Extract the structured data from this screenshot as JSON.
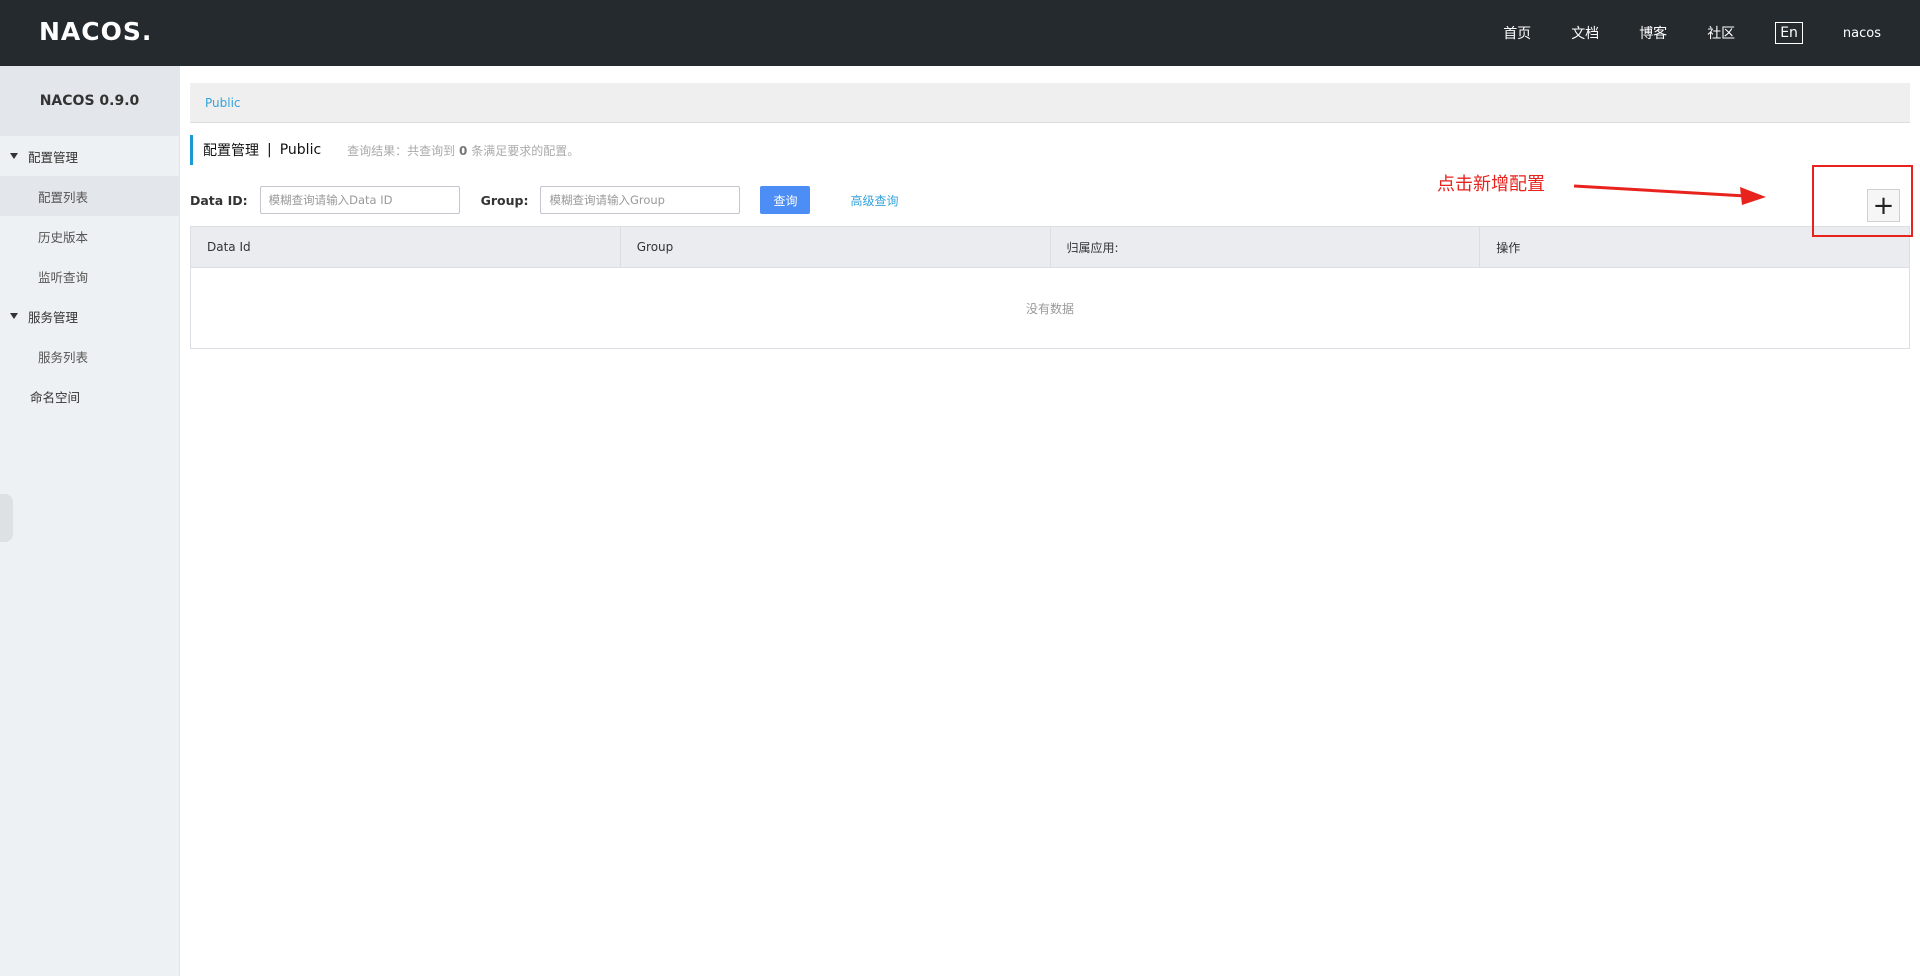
{
  "header": {
    "logo": "NACOS.",
    "nav": [
      "首页",
      "文档",
      "博客",
      "社区"
    ],
    "lang": "En",
    "user": "nacos"
  },
  "sidebar": {
    "title": "NACOS 0.9.0",
    "groups": [
      {
        "label": "配置管理",
        "items": [
          "配置列表",
          "历史版本",
          "监听查询"
        ]
      },
      {
        "label": "服务管理",
        "items": [
          "服务列表"
        ]
      }
    ],
    "top_item": "命名空间"
  },
  "breadcrumb": "Public",
  "page": {
    "title": "配置管理",
    "separator": "|",
    "namespace": "Public",
    "result_prefix": "查询结果：共查询到",
    "result_count": "0",
    "result_suffix": "条满足要求的配置。"
  },
  "search": {
    "dataid_label": "Data ID:",
    "dataid_placeholder": "模糊查询请输入Data ID",
    "group_label": "Group:",
    "group_placeholder": "模糊查询请输入Group",
    "query_button": "查询",
    "advanced_link": "高级查询"
  },
  "annotation": {
    "text": "点击新增配置",
    "color": "#e8231d"
  },
  "add_button_symbol": "+",
  "table": {
    "columns": [
      "Data Id",
      "Group",
      "归属应用:",
      "操作"
    ],
    "empty_text": "没有数据"
  },
  "colors": {
    "header_bg": "#252a2f",
    "accent": "#4c8df6",
    "link": "#33a3dc"
  }
}
